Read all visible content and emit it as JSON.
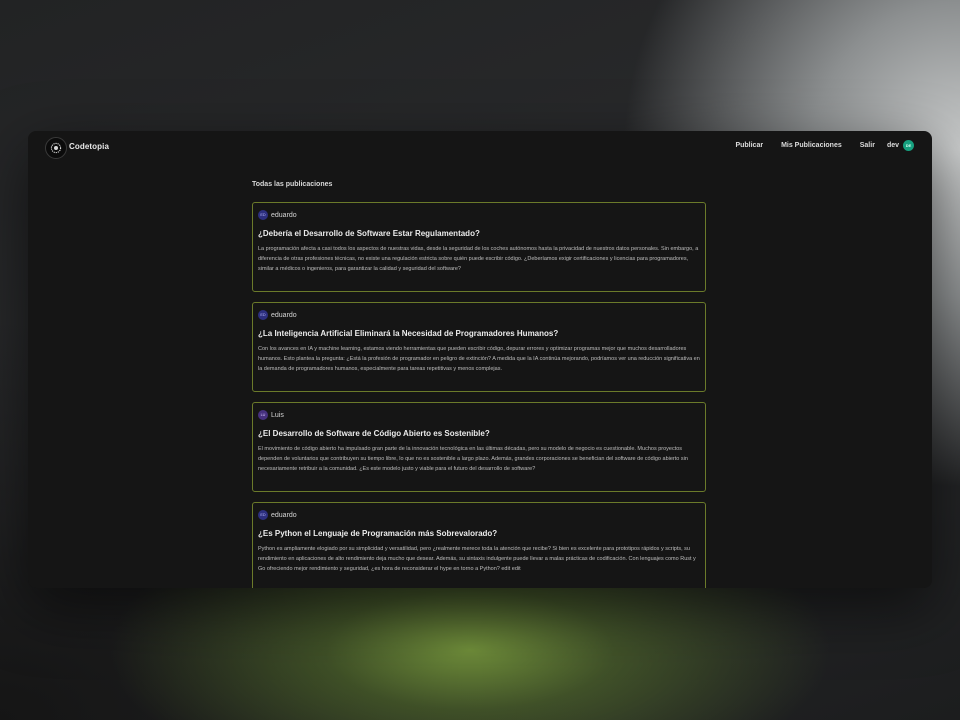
{
  "app": {
    "name": "Codetopia"
  },
  "nav": {
    "publish": "Publicar",
    "my_posts": "Mis Publicaciones",
    "logout": "Salir",
    "user": "dev",
    "user_initials": "DE"
  },
  "feed": {
    "title": "Todas las publicaciones",
    "posts": [
      {
        "author": "eduardo",
        "initials": "ED",
        "title": "¿Debería el Desarrollo de Software Estar Regulamentado?",
        "body": "La programación afecta a casi todos los aspectos de nuestras vidas, desde la seguridad de los coches autónomos hasta la privacidad de nuestros datos personales. Sin embargo, a diferencia de otras profesiones técnicas, no existe una regulación estricta sobre quién puede escribir código. ¿Deberíamos exigir certificaciones y licencias para programadores, similar a médicos o ingenieros, para garantizar la calidad y seguridad del software?"
      },
      {
        "author": "eduardo",
        "initials": "ED",
        "title": "¿La Inteligencia Artificial Eliminará la Necesidad de Programadores Humanos?",
        "body": "Con los avances en IA y machine learning, estamos viendo herramientas que pueden escribir código, depurar errores y optimizar programas mejor que muchos desarrolladores humanos. Esto plantea la pregunta: ¿Está la profesión de programador en peligro de extinción? A medida que la IA continúa mejorando, podríamos ver una reducción significativa en la demanda de programadores humanos, especialmente para tareas repetitivas y menos complejas."
      },
      {
        "author": "Luis",
        "initials": "LU",
        "title": "¿El Desarrollo de Software de Código Abierto es Sostenible?",
        "body": "El movimiento de código abierto ha impulsado gran parte de la innovación tecnológica en las últimas décadas, pero su modelo de negocio es cuestionable. Muchos proyectos dependen de voluntarios que contribuyen su tiempo libre, lo que no es sostenible a largo plazo. Además, grandes corporaciones se benefician del software de código abierto sin necesariamente retribuir a la comunidad. ¿Es este modelo justo y viable para el futuro del desarrollo de software?"
      },
      {
        "author": "eduardo",
        "initials": "ED",
        "title": "¿Es Python el Lenguaje de Programación más Sobrevalorado?",
        "body": "Python es ampliamente elogiado por su simplicidad y versatilidad, pero ¿realmente merece toda la atención que recibe? Si bien es excelente para prototipos rápidos y scripts, su rendimiento en aplicaciones de alto rendimiento deja mucho que desear. Además, su sintaxis indulgente puede llevar a malas prácticas de codificación. Con lenguajes como Rust y Go ofreciendo mejor rendimiento y seguridad, ¿es hora de reconsiderar el hype en torno a Python? edit edit"
      }
    ]
  }
}
